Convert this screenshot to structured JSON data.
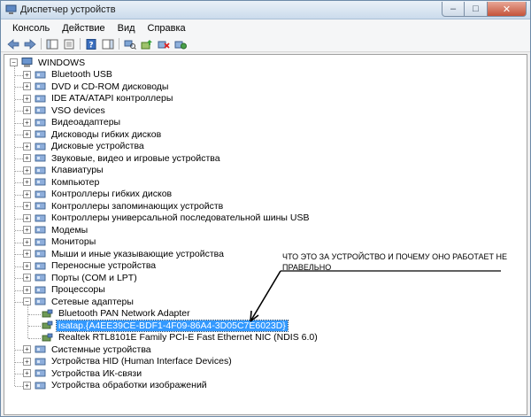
{
  "window": {
    "title": "Диспетчер устройств",
    "controls": {
      "minimize": "–",
      "maximize": "□",
      "close": "✕"
    }
  },
  "menubar": [
    "Консоль",
    "Действие",
    "Вид",
    "Справка"
  ],
  "toolbar_icons": [
    "back-arrow-icon",
    "forward-arrow-icon",
    "console-tree-icon",
    "properties-icon",
    "help-icon",
    "action-pane-icon",
    "scan-hardware-icon",
    "update-driver-icon",
    "disable-device-icon",
    "uninstall-device-icon"
  ],
  "tree": {
    "root": "WINDOWS",
    "categories": [
      "Bluetooth USB",
      "DVD и CD-ROM дисководы",
      "IDE ATA/ATAPI контроллеры",
      "VSO devices",
      "Видеоадаптеры",
      "Дисководы гибких дисков",
      "Дисковые устройства",
      "Звуковые, видео и игровые устройства",
      "Клавиатуры",
      "Компьютер",
      "Контроллеры гибких дисков",
      "Контроллеры запоминающих устройств",
      "Контроллеры универсальной последовательной шины USB",
      "Модемы",
      "Мониторы",
      "Мыши и иные указывающие устройства",
      "Переносные устройства",
      "Порты (COM и LPT)",
      "Процессоры",
      "Сетевые адаптеры"
    ],
    "network_children": [
      "Bluetooth PAN Network Adapter",
      "isatap.{A4EE39CE-BDF1-4F09-86A4-3D05C7E6023D}",
      "Realtek RTL8101E Family PCI-E Fast Ethernet NIC (NDIS 6.0)"
    ],
    "after_categories": [
      "Системные устройства",
      "Устройства HID (Human Interface Devices)",
      "Устройства ИК-связи",
      "Устройства обработки изображений"
    ],
    "expand_collapsed": "+",
    "expand_open": "−"
  },
  "annotation": {
    "line1": "ЧТО ЭТО ЗА УСТРОЙСТВО И ПОЧЕМУ ОНО РАБОТАЕТ НЕ",
    "line2": "ПРАВЕЛЬНО"
  },
  "colors": {
    "selection": "#3399ff",
    "title_gradient_top": "#e9f0f7",
    "close_button": "#c4533a"
  }
}
